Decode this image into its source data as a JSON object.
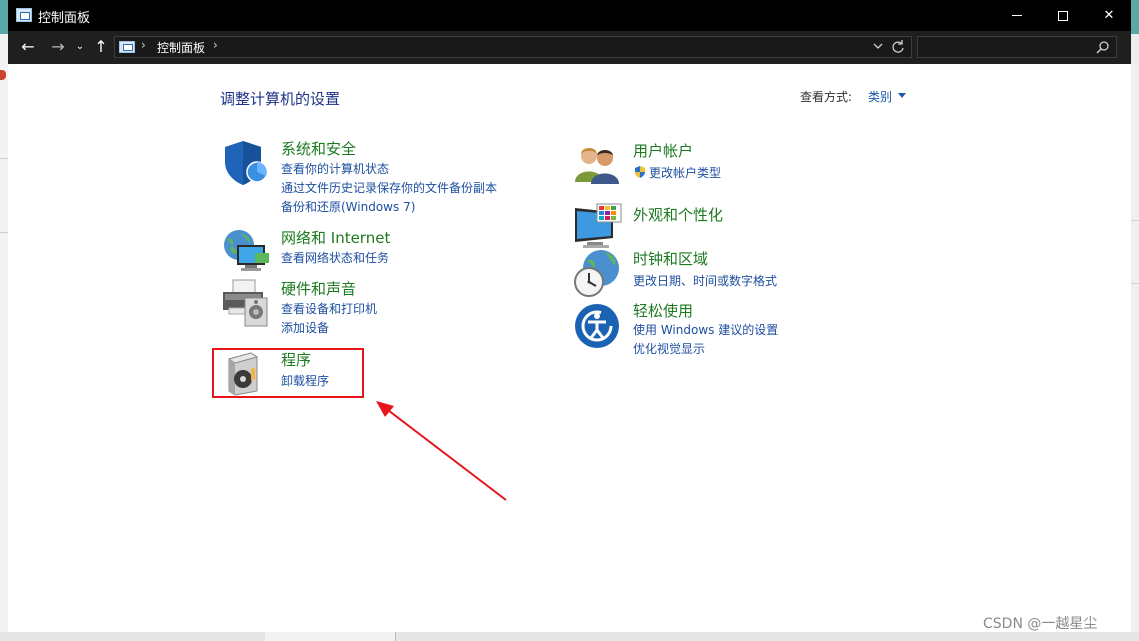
{
  "window": {
    "title": "控制面板",
    "controls": {
      "minimize": "minimize-icon",
      "maximize": "maximize-icon",
      "close": "✕"
    }
  },
  "navigation": {
    "back": "←",
    "forward": "→",
    "recent": "⌄",
    "up": "↑",
    "address": {
      "separator": "›",
      "crumb": "控制面板"
    },
    "search": {
      "placeholder": ""
    }
  },
  "main": {
    "heading": "调整计算机的设置",
    "view_by_label": "查看方式:",
    "view_by_value": "类别",
    "categories": [
      {
        "id": "system-security",
        "title": "系统和安全",
        "icon": "shield-icon",
        "links": [
          "查看你的计算机状态",
          "通过文件历史记录保存你的文件备份副本",
          "备份和还原(Windows 7)"
        ]
      },
      {
        "id": "network",
        "title": "网络和 Internet",
        "icon": "network-globe-icon",
        "links": [
          "查看网络状态和任务"
        ]
      },
      {
        "id": "hardware",
        "title": "硬件和声音",
        "icon": "printer-speaker-icon",
        "links": [
          "查看设备和打印机",
          "添加设备"
        ]
      },
      {
        "id": "programs",
        "title": "程序",
        "icon": "programs-disc-icon",
        "links": [
          "卸载程序"
        ]
      },
      {
        "id": "user-accounts",
        "title": "用户帐户",
        "icon": "users-icon",
        "links": [
          "更改帐户类型"
        ]
      },
      {
        "id": "appearance",
        "title": "外观和个性化",
        "icon": "monitor-palette-icon",
        "links": []
      },
      {
        "id": "clock-region",
        "title": "时钟和区域",
        "icon": "clock-globe-icon",
        "links": [
          "更改日期、时间或数字格式"
        ]
      },
      {
        "id": "ease-of-access",
        "title": "轻松使用",
        "icon": "ease-of-access-icon",
        "links": [
          "使用 Windows 建议的设置",
          "优化视觉显示"
        ]
      }
    ]
  },
  "colors": {
    "category_title": "#1c7a1f",
    "link": "#1e4fa0",
    "highlight": "#e8141b",
    "annotation_arrow": "#e8141b"
  },
  "watermark": "CSDN @一越星尘"
}
